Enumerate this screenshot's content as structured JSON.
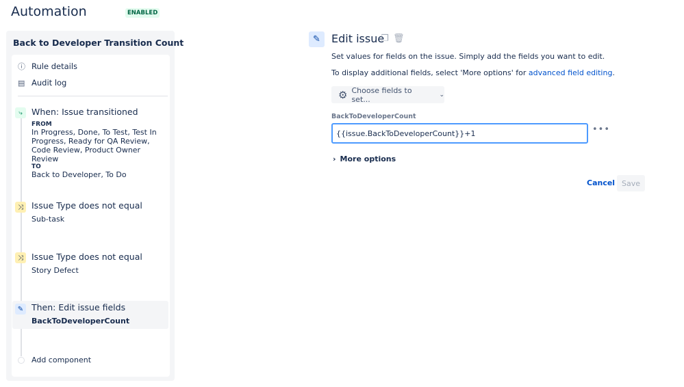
{
  "header": {
    "title": "Automation",
    "status": "ENABLED"
  },
  "sidebar": {
    "rule_name": "Back to Developer Transition Count",
    "nav": [
      {
        "label": "Rule details",
        "icon": "info-icon"
      },
      {
        "label": "Audit log",
        "icon": "document-icon"
      }
    ],
    "trigger": {
      "title": "When: Issue transitioned",
      "from_label": "FROM",
      "from": "In Progress, Done, To Test, Test In Progress, Ready for QA Review, Code Review, Product Owner Review",
      "to_label": "TO",
      "to": "Back to Developer, To Do"
    },
    "conditions": [
      {
        "title": "Issue Type does not equal",
        "value": "Sub-task"
      },
      {
        "title": "Issue Type does not equal",
        "value": "Story Defect"
      }
    ],
    "action": {
      "title": "Then: Edit issue fields",
      "value": "BackToDeveloperCount"
    },
    "add_component": "Add component"
  },
  "editor": {
    "title": "Edit issue",
    "desc1": "Set values for fields on the issue. Simply add the fields you want to edit.",
    "desc2_prefix": "To display additional fields, select 'More options' for ",
    "desc2_link": "advanced field editing",
    "desc2_suffix": ".",
    "choose_button": "Choose fields to set...",
    "field_label": "BackToDeveloperCount",
    "field_value": "{{issue.BackToDeveloperCount}}+1",
    "more_options": "More options",
    "cancel": "Cancel",
    "save": "Save"
  },
  "colors": {
    "accent": "#0052cc",
    "enabled_bg": "#e3fcef",
    "trigger_bg": "#e3fcef",
    "condition_bg": "#fff0b3",
    "action_bg": "#deebff"
  }
}
